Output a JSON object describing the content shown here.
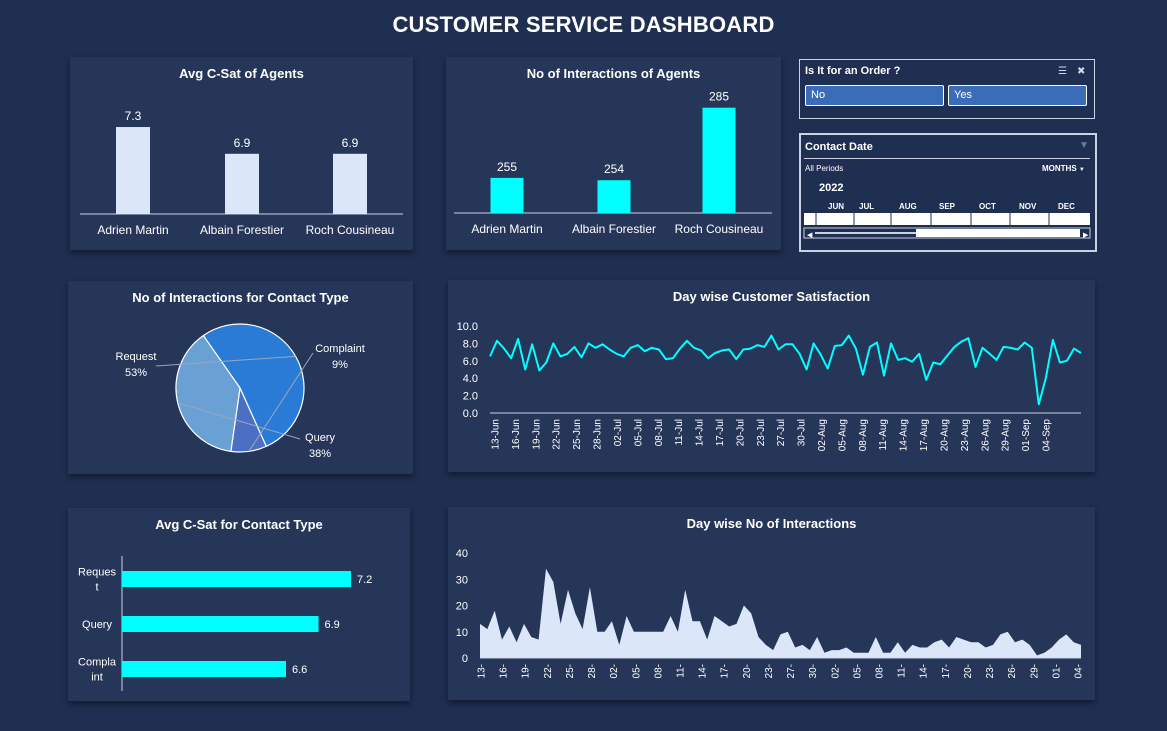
{
  "title": "CUSTOMER SERVICE DASHBOARD",
  "colors": {
    "bg": "#1f2f52",
    "panel": "#263659",
    "accent": "#00ffff",
    "light_bar": "#dbe7f8"
  },
  "panels": {
    "avg_csat_agents": "Avg C-Sat of Agents",
    "interactions_agents": "No of Interactions of Agents",
    "interactions_contact_type": "No of Interactions for Contact Type",
    "daywise_csat": "Day wise Customer Satisfaction",
    "avg_csat_contact_type": "Avg C-Sat for Contact Type",
    "daywise_interactions": "Day wise No of Interactions"
  },
  "order_slicer": {
    "title": "Is It for an Order ?",
    "options": [
      "No",
      "Yes"
    ],
    "icons": [
      "multi-select-icon",
      "clear-filter-icon"
    ]
  },
  "date_slicer": {
    "title": "Contact Date",
    "periods_label": "All Periods",
    "level_label": "MONTHS",
    "year": "2022",
    "months": [
      "JUN",
      "JUL",
      "AUG",
      "SEP",
      "OCT",
      "NOV",
      "DEC"
    ],
    "selected_range": [
      "JUN",
      "SEP"
    ],
    "icons": [
      "clear-filter-icon",
      "dropdown-arrow-icon"
    ]
  },
  "chart_data": [
    {
      "id": "avg_csat_agents",
      "type": "bar",
      "title": "Avg C-Sat of Agents",
      "categories": [
        "Adrien Martin",
        "Albain Forestier",
        "Roch Cousineau"
      ],
      "values": [
        7.3,
        6.9,
        6.9
      ],
      "labels": [
        "7.3",
        "6.9",
        "6.9"
      ],
      "ylim": [
        6,
        7.45
      ]
    },
    {
      "id": "interactions_agents",
      "type": "bar",
      "title": "No of Interactions of Agents",
      "categories": [
        "Adrien Martin",
        "Albain Forestier",
        "Roch Cousineau"
      ],
      "values": [
        255,
        254,
        285
      ],
      "labels": [
        "255",
        "254",
        "285"
      ],
      "ylim": [
        240,
        287
      ]
    },
    {
      "id": "interactions_contact_type",
      "type": "pie",
      "title": "No of Interactions for Contact Type",
      "slices": [
        {
          "name": "Request",
          "value": 53,
          "label": "53%",
          "color": "#2a7bd6"
        },
        {
          "name": "Complaint",
          "value": 9,
          "label": "9%",
          "color": "#4b6fc2"
        },
        {
          "name": "Query",
          "value": 38,
          "label": "38%",
          "color": "#6aa1d4"
        }
      ]
    },
    {
      "id": "daywise_csat",
      "type": "line",
      "title": "Day wise Customer Satisfaction",
      "yticks": [
        "0.0",
        "2.0",
        "4.0",
        "6.0",
        "8.0",
        "10.0"
      ],
      "ylim": [
        0,
        10
      ],
      "xticks": [
        "13-Jun",
        "16-Jun",
        "19-Jun",
        "22-Jun",
        "25-Jun",
        "28-Jun",
        "02-Jul",
        "05-Jul",
        "08-Jul",
        "11-Jul",
        "14-Jul",
        "17-Jul",
        "20-Jul",
        "23-Jul",
        "27-Jul",
        "30-Jul",
        "02-Aug",
        "05-Aug",
        "08-Aug",
        "11-Aug",
        "14-Aug",
        "17-Aug",
        "20-Aug",
        "23-Aug",
        "26-Aug",
        "29-Aug",
        "01-Sep",
        "04-Sep"
      ],
      "values": [
        6.5,
        8.3,
        7.4,
        6.3,
        8.5,
        5.0,
        7.9,
        4.9,
        5.8,
        8.0,
        6.5,
        6.8,
        7.6,
        6.4,
        8.0,
        7.5,
        7.9,
        7.3,
        6.8,
        6.5,
        7.5,
        7.8,
        7.1,
        7.5,
        7.3,
        6.2,
        6.3,
        7.4,
        8.3,
        7.5,
        7.2,
        6.3,
        6.9,
        7.2,
        7.3,
        6.2,
        7.3,
        7.4,
        7.8,
        7.6,
        8.9,
        7.3,
        7.9,
        7.9,
        6.8,
        5.0,
        8.0,
        6.7,
        5.1,
        7.7,
        7.8,
        8.9,
        7.4,
        4.4,
        7.6,
        8.1,
        4.3,
        8.0,
        6.1,
        6.3,
        5.9,
        6.8,
        3.8,
        5.8,
        5.6,
        6.6,
        7.6,
        8.2,
        8.6,
        5.3,
        7.5,
        6.8,
        6.1,
        7.6,
        7.5,
        7.3,
        8.1,
        7.5,
        1.0,
        4.0,
        8.4,
        5.8,
        6.0,
        7.4,
        6.9
      ]
    },
    {
      "id": "avg_csat_contact_type",
      "type": "bar",
      "orientation": "horizontal",
      "title": "Avg C-Sat for Contact Type",
      "categories": [
        "Reques\nt",
        "Query",
        "Compla\nint"
      ],
      "values": [
        7.2,
        6.9,
        6.6
      ],
      "labels": [
        "7.2",
        "6.9",
        "6.6"
      ],
      "xlim": [
        6.0,
        7.2
      ]
    },
    {
      "id": "daywise_interactions",
      "type": "area",
      "title": "Day wise No of Interactions",
      "yticks": [
        "0",
        "10",
        "20",
        "30",
        "40"
      ],
      "ylim": [
        0,
        40
      ],
      "xticks": [
        "13-",
        "16-",
        "19-",
        "22-",
        "25-",
        "28-",
        "02-",
        "05-",
        "08-",
        "11-",
        "14-",
        "17-",
        "20-",
        "23-",
        "27-",
        "30-",
        "02-",
        "05-",
        "08-",
        "11-",
        "14-",
        "17-",
        "20-",
        "23-",
        "26-",
        "29-",
        "01-",
        "04-"
      ],
      "values": [
        13,
        11,
        18,
        7,
        12,
        6,
        13,
        8,
        7,
        34,
        29,
        13,
        26,
        17,
        11,
        27,
        10,
        10,
        14,
        5,
        16,
        10,
        10,
        10,
        10,
        10,
        16,
        10,
        26,
        14,
        14,
        7,
        16,
        14,
        12,
        13,
        20,
        17,
        8,
        5,
        3,
        9,
        10,
        4,
        5,
        3,
        8,
        2,
        3,
        3,
        4,
        2,
        2,
        2,
        8,
        2,
        2,
        6,
        2,
        5,
        4,
        4,
        6,
        7,
        4,
        8,
        7,
        6,
        6,
        4,
        5,
        9,
        10,
        6,
        7,
        5,
        1,
        2,
        4,
        7,
        9,
        6,
        5
      ]
    }
  ]
}
